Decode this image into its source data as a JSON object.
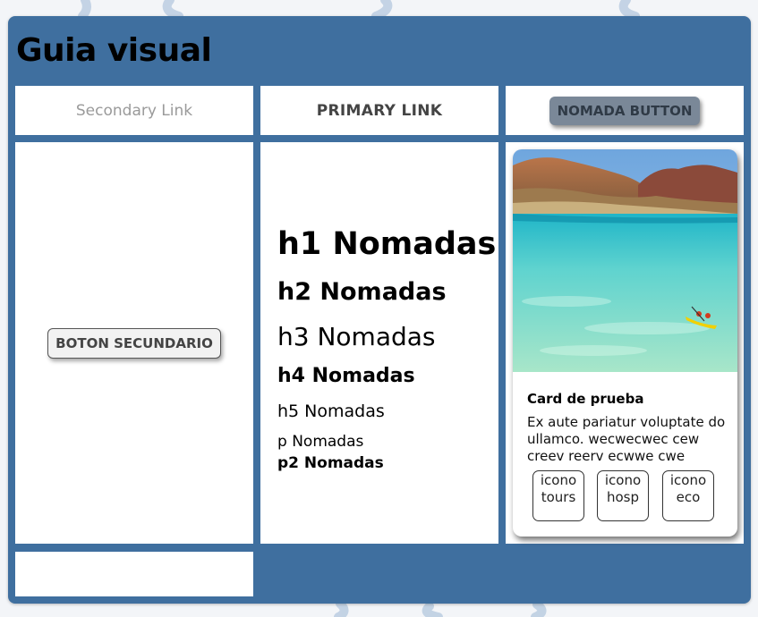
{
  "page": {
    "title": "Guia visual"
  },
  "links": {
    "secondary": "Secondary Link",
    "primary": "PRIMARY LINK"
  },
  "buttons": {
    "nomada": "NOMADA BUTTON",
    "secundario": "BOTON SECUNDARIO"
  },
  "typography": {
    "h1": "h1 Nomadas",
    "h2": "h2 Nomadas",
    "h3": "h3 Nomadas",
    "h4": "h4 Nomadas",
    "h5": "h5 Nomadas",
    "p": "p Nomadas",
    "p2": "p2 Nomadas"
  },
  "card": {
    "title": "Card de prueba",
    "text": "Ex aute pariatur voluptate do ullamco. wecwecwec cew creev reerv ecwwe cwe cwe...",
    "image": "beach-kayak-photo",
    "icons": [
      {
        "line1": "icono",
        "line2": "tours"
      },
      {
        "line1": "icono",
        "line2": "hosp"
      },
      {
        "line1": "icono",
        "line2": "eco"
      }
    ]
  },
  "colors": {
    "panel": "#3f6f9f",
    "nomada_button": "#7a8898",
    "secondary_link": "#9a9a9a"
  }
}
